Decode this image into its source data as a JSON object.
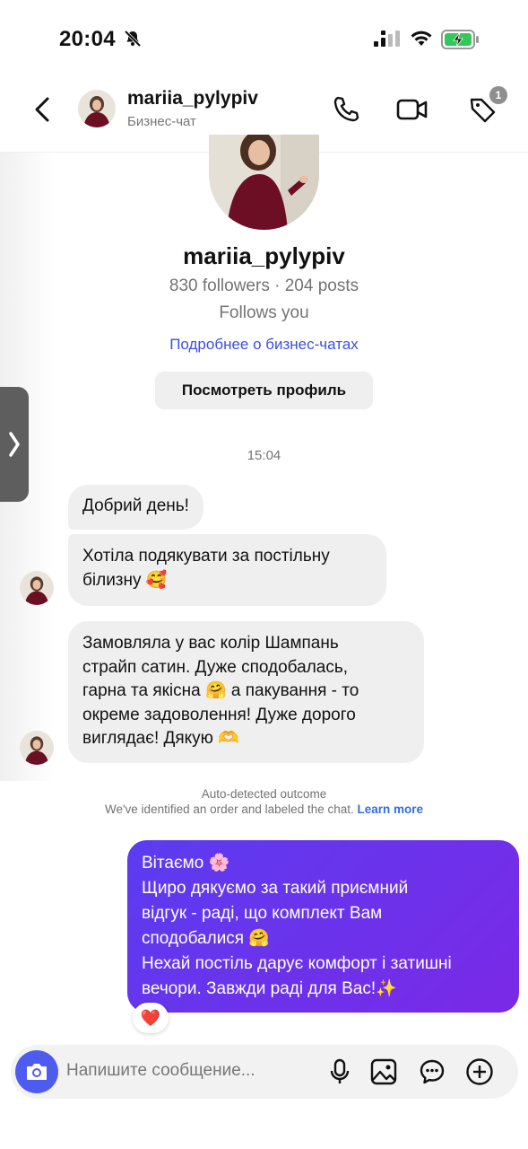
{
  "status_bar": {
    "time": "20:04"
  },
  "header": {
    "username": "mariia_pylypiv",
    "subtitle": "Бизнес-чат",
    "tag_badge_count": "1"
  },
  "profile": {
    "username": "mariia_pylypiv",
    "stats": "830 followers · 204 posts",
    "follows": "Follows you",
    "business_link": "Подробнее о бизнес-чатах",
    "view_profile_label": "Посмотреть профиль"
  },
  "chat": {
    "timestamp": "15:04",
    "incoming": [
      {
        "lines": [
          "Добрий день!"
        ]
      },
      {
        "lines": [
          "Хотіла подякувати за постільну",
          "білизну 🥰"
        ]
      },
      {
        "lines": [
          "Замовляла у вас колір Шампань",
          "страйп сатин. Дуже сподобалась,",
          "гарна та якісна 🤗 а пакування - то",
          "окреме задоволення! Дуже дорого",
          "виглядає! Дякую 🫶"
        ]
      }
    ],
    "outcome": {
      "title": "Auto-detected outcome",
      "description": "We've identified an order and labeled the chat.",
      "learn_more": "Learn more"
    },
    "outgoing": {
      "lines": [
        "Вітаємо 🌸",
        "Щиро дякуємо за такий приємний",
        "відгук - раді, що комплект Вам",
        "сподобалися 🤗",
        "Нехай постіль дарує комфорт і затишні",
        "вечори. Завжди раді для Вас!✨"
      ],
      "reaction": "❤️"
    }
  },
  "composer": {
    "placeholder": "Напишите сообщение..."
  },
  "colors": {
    "accent": "#4e5bf0",
    "outgoing_bubble": "#6a2de8",
    "link": "#3c4fe0"
  }
}
